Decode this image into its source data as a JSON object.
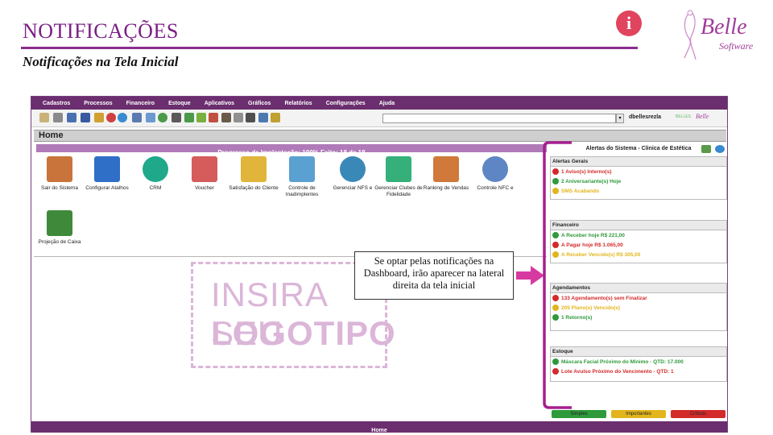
{
  "slide": {
    "title": "NOTIFICAÇÕES",
    "subtitle": "Notificações na Tela Inicial"
  },
  "brand": {
    "name": "Belle",
    "tagline": "Software"
  },
  "menu": [
    "Cadastros",
    "Processos",
    "Financeiro",
    "Estoque",
    "Aplicativos",
    "Gráficos",
    "Relatórios",
    "Configurações",
    "Ajuda"
  ],
  "toolbar": {
    "user_label": "dbellesrezla",
    "logo_small_1": "BELLES",
    "logo_small_2": "Belle"
  },
  "home": {
    "title": "Home",
    "progress_text": "Progresso da Implantação: 100%    Feito: 18 de 18"
  },
  "tiles": [
    {
      "label": "Sair do Sistema",
      "icon": "door-exit-icon",
      "color": "#c8743a"
    },
    {
      "label": "Configurar Atalhos",
      "icon": "shortcut-arrow-icon",
      "color": "#2f6fc7"
    },
    {
      "label": "CRM",
      "icon": "crm-people-icon",
      "color": "#1fa88a"
    },
    {
      "label": "Voucher",
      "icon": "gift-voucher-icon",
      "color": "#d65b5b"
    },
    {
      "label": "Satisfação do Cliente",
      "icon": "satisfaction-faces-icon",
      "color": "#e0b53a"
    },
    {
      "label": "Controle de Inadimplentes",
      "icon": "document-check-icon",
      "color": "#5aa0d0"
    },
    {
      "label": "Gerenciar NFS e",
      "icon": "nfse-seal-icon",
      "color": "#3a88b8"
    },
    {
      "label": "Gerenciar Clubes de Fidelidade",
      "icon": "diamond-club-icon",
      "color": "#35b07a"
    },
    {
      "label": "Ranking de Vendas",
      "icon": "ranking-chart-icon",
      "color": "#d0793a"
    },
    {
      "label": "Controle NFC e",
      "icon": "nfce-seal-icon",
      "color": "#5e86c5"
    },
    {
      "label": "Projeção de Caixa",
      "icon": "cash-projection-icon",
      "color": "#3f8a3a"
    }
  ],
  "logo_placeholder": {
    "line1": "INSIRA SEU",
    "line2": "LOGOTIPO"
  },
  "callout": {
    "text": "Se optar pelas notificações na Dashboard, irão aparecer na lateral direita da tela inicial"
  },
  "panel": {
    "title": "Alertas do Sistema - Clinica de Estética",
    "sections": [
      {
        "title": "Alertas Gerais",
        "rows": [
          {
            "text": "1 Aviso(s) Interno(s)",
            "status": "red"
          },
          {
            "text": "2 Aniversariante(s) Hoje",
            "status": "green"
          },
          {
            "text": "SMS Acabando",
            "status": "yellow"
          }
        ]
      },
      {
        "title": "Financeiro",
        "rows": [
          {
            "text": "A Receber hoje R$ 221,00",
            "status": "green"
          },
          {
            "text": "A Pagar hoje R$ 1.065,00",
            "status": "red"
          },
          {
            "text": "A Receber Vencido(s) R$ 305,00",
            "status": "yellow"
          }
        ]
      },
      {
        "title": "Agendamentos",
        "rows": [
          {
            "text": "133 Agendamento(s) sem Finalizar",
            "status": "red"
          },
          {
            "text": "205 Plano(s) Vencido(s)",
            "status": "yellow"
          },
          {
            "text": "1 Retorno(s)",
            "status": "green"
          }
        ]
      },
      {
        "title": "Estoque",
        "rows": [
          {
            "text": "Máscara Facial Próximo do Mínimo - QTD: 17.000",
            "status": "green"
          },
          {
            "text": "Lote Avulso Próximo do Vencimento - QTD: 1",
            "status": "red"
          }
        ]
      }
    ],
    "legend": [
      {
        "label": "Simples",
        "color": "#2e9a3a"
      },
      {
        "label": "Importantes",
        "color": "#e3b51c"
      },
      {
        "label": "Críticos",
        "color": "#d42a2a"
      }
    ]
  },
  "status_colors": {
    "red": "#d42a2a",
    "green": "#2e9a3a",
    "yellow": "#e3b51c"
  },
  "footer": {
    "label": "Home"
  }
}
